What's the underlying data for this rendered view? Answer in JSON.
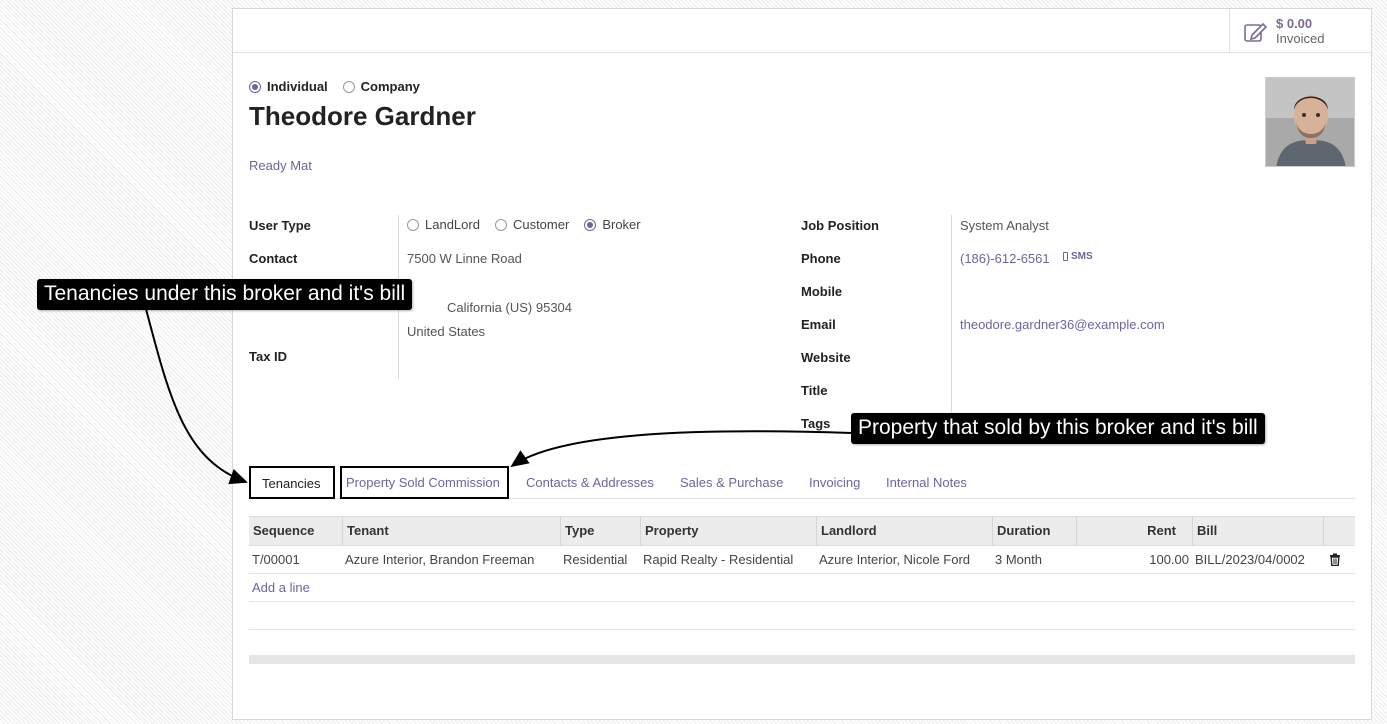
{
  "stat_button": {
    "value": "$ 0.00",
    "label": "Invoiced",
    "icon": "pencil-square-icon"
  },
  "partner_type": {
    "options": [
      {
        "label": "Individual",
        "selected": true
      },
      {
        "label": "Company",
        "selected": false
      }
    ]
  },
  "partner": {
    "name": "Theodore Gardner",
    "company": "Ready Mat"
  },
  "left_fields": {
    "user_type_label": "User Type",
    "user_type_options": [
      {
        "label": "LandLord",
        "selected": false
      },
      {
        "label": "Customer",
        "selected": false
      },
      {
        "label": "Broker",
        "selected": true
      }
    ],
    "contact_label": "Contact",
    "street": "7500 W Linne Road",
    "city_state_zip": "California (US)  95304",
    "country": "United States",
    "tax_id_label": "Tax ID"
  },
  "right_fields": {
    "job_position_label": "Job Position",
    "job_position": "System Analyst",
    "phone_label": "Phone",
    "phone": "(186)-612-6561",
    "sms_label": "SMS",
    "mobile_label": "Mobile",
    "email_label": "Email",
    "email": "theodore.gardner36@example.com",
    "website_label": "Website",
    "title_label": "Title",
    "tags_label": "Tags"
  },
  "tabs": [
    {
      "label": "Tenancies",
      "active": true
    },
    {
      "label": "Property Sold Commission",
      "active": false
    },
    {
      "label": "Contacts & Addresses",
      "active": false
    },
    {
      "label": "Sales & Purchase",
      "active": false
    },
    {
      "label": "Invoicing",
      "active": false
    },
    {
      "label": "Internal Notes",
      "active": false
    }
  ],
  "table": {
    "columns": [
      "Sequence",
      "Tenant",
      "Type",
      "Property",
      "Landlord",
      "Duration",
      "Rent",
      "Bill"
    ],
    "rows": [
      {
        "sequence": "T/00001",
        "tenant": "Azure Interior, Brandon Freeman",
        "type": "Residential",
        "property": "Rapid Realty - Residential",
        "landlord": "Azure Interior, Nicole Ford",
        "duration": "3 Month",
        "rent": "100.00",
        "bill": "BILL/2023/04/0002"
      }
    ],
    "add_line": "Add a line"
  },
  "annotations": {
    "tenancies_note": "Tenancies under this broker and it's bill",
    "property_note": "Property that sold by this broker and it's bill"
  },
  "colors": {
    "accent": "#71639e",
    "callout_bg": "#000000"
  }
}
